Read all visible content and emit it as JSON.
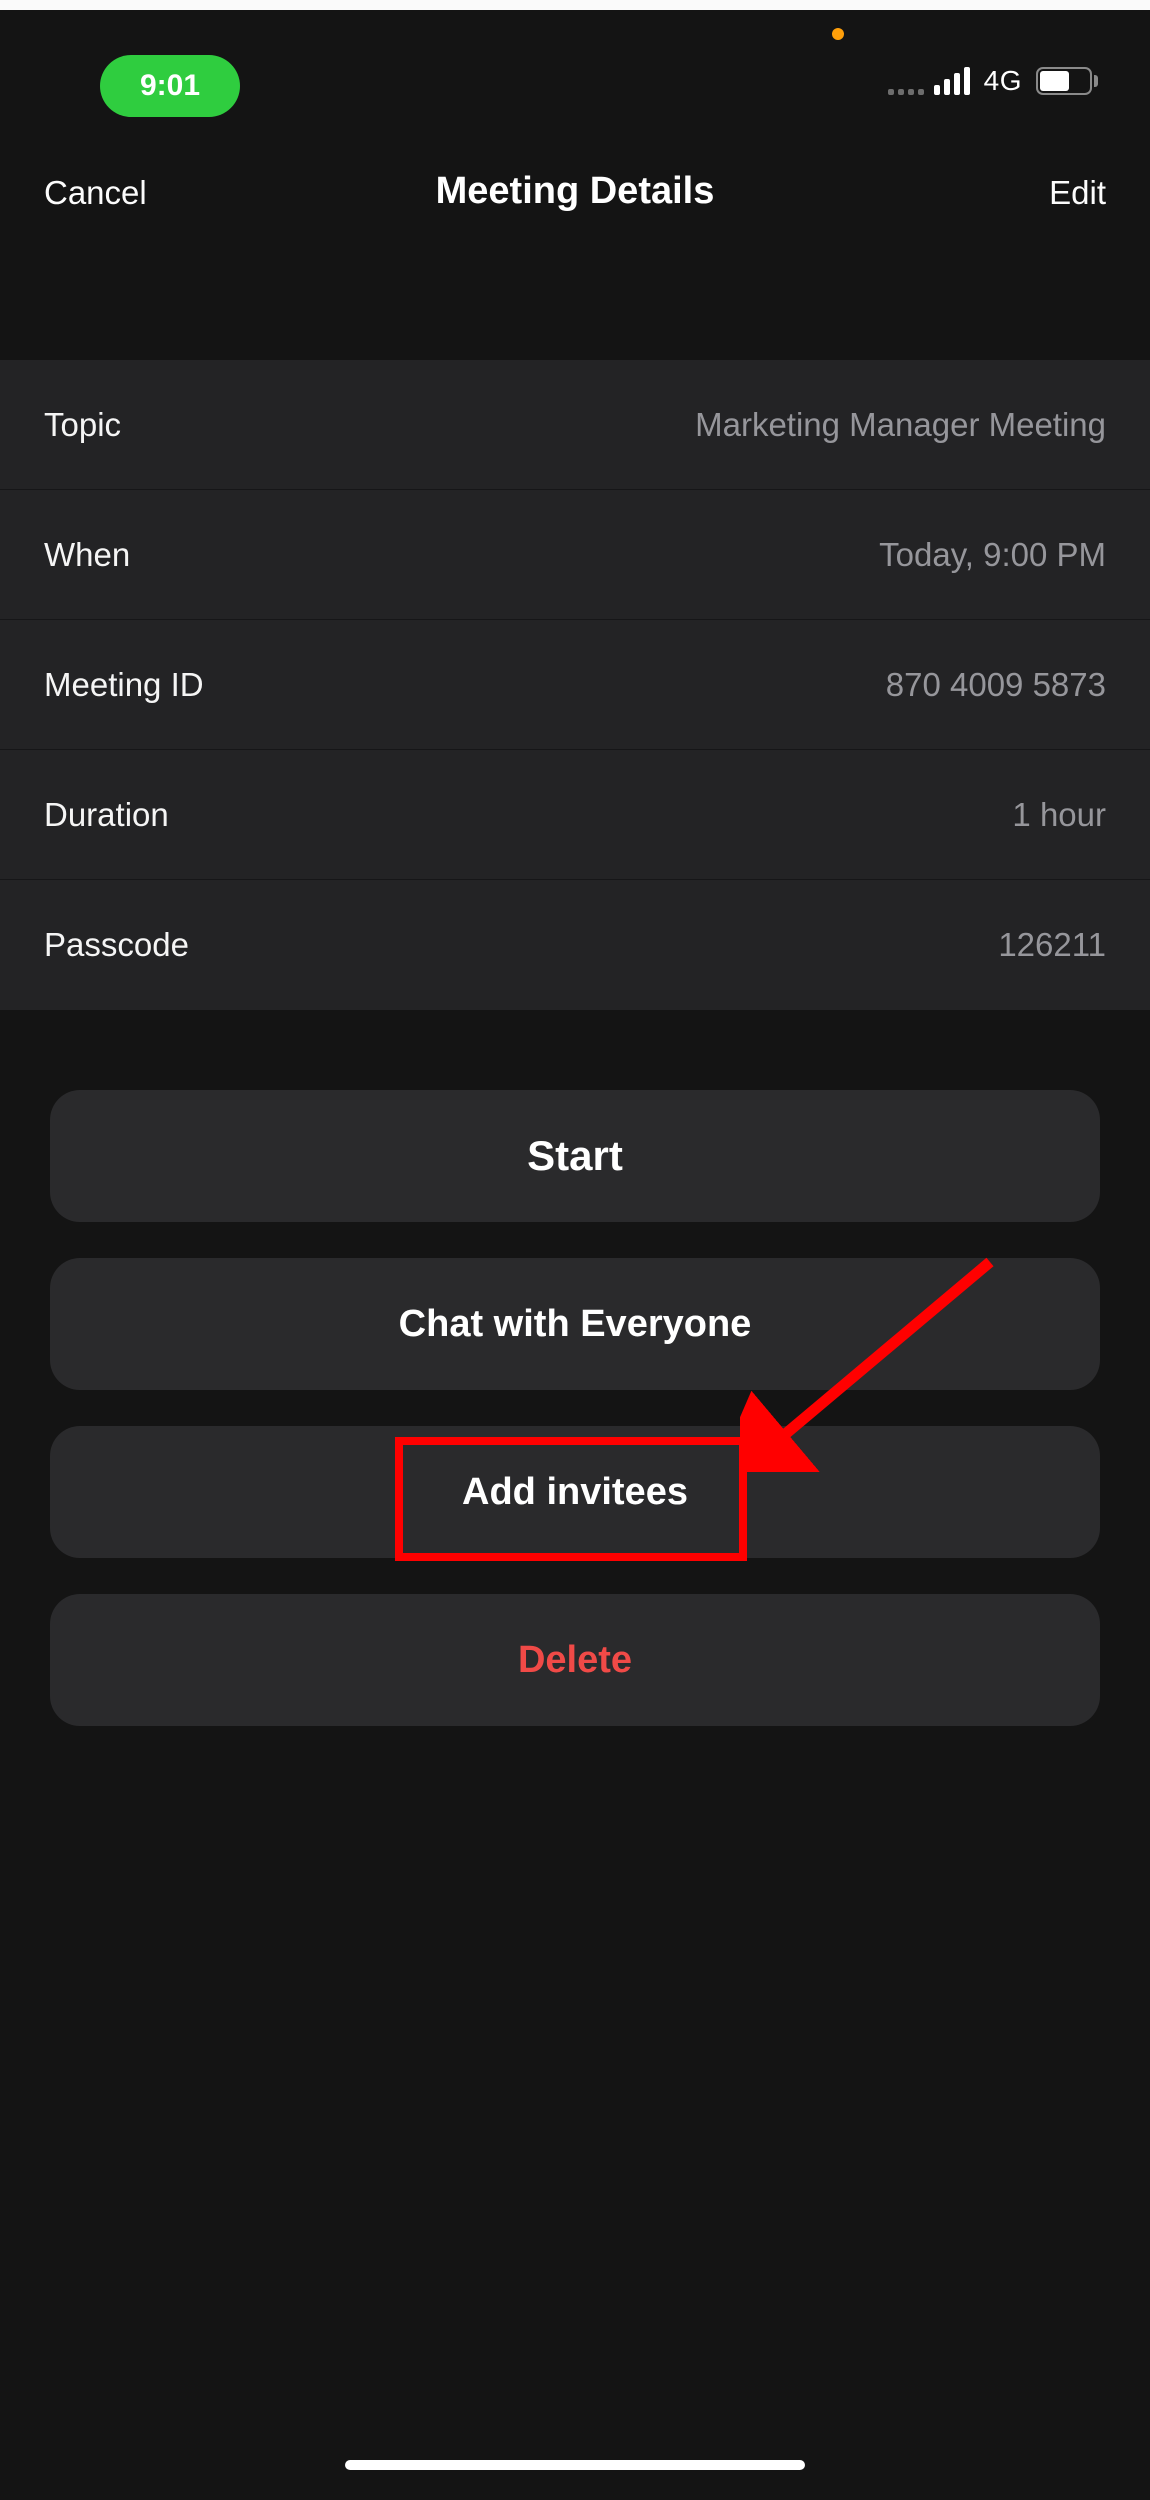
{
  "status_bar": {
    "time": "9:01",
    "network_label": "4G"
  },
  "header": {
    "cancel": "Cancel",
    "title": "Meeting Details",
    "edit": "Edit"
  },
  "details": {
    "topic_label": "Topic",
    "topic_value": "Marketing Manager Meeting",
    "when_label": "When",
    "when_value": "Today, 9:00 PM",
    "meeting_id_label": "Meeting ID",
    "meeting_id_value": "870 4009 5873",
    "duration_label": "Duration",
    "duration_value": "1 hour",
    "passcode_label": "Passcode",
    "passcode_value": "126211"
  },
  "buttons": {
    "start": "Start",
    "chat": "Chat with Everyone",
    "add_invitees": "Add invitees",
    "delete": "Delete"
  },
  "annotation": {
    "highlight_target": "add-invitees-button",
    "highlight_color": "#ff0000"
  }
}
